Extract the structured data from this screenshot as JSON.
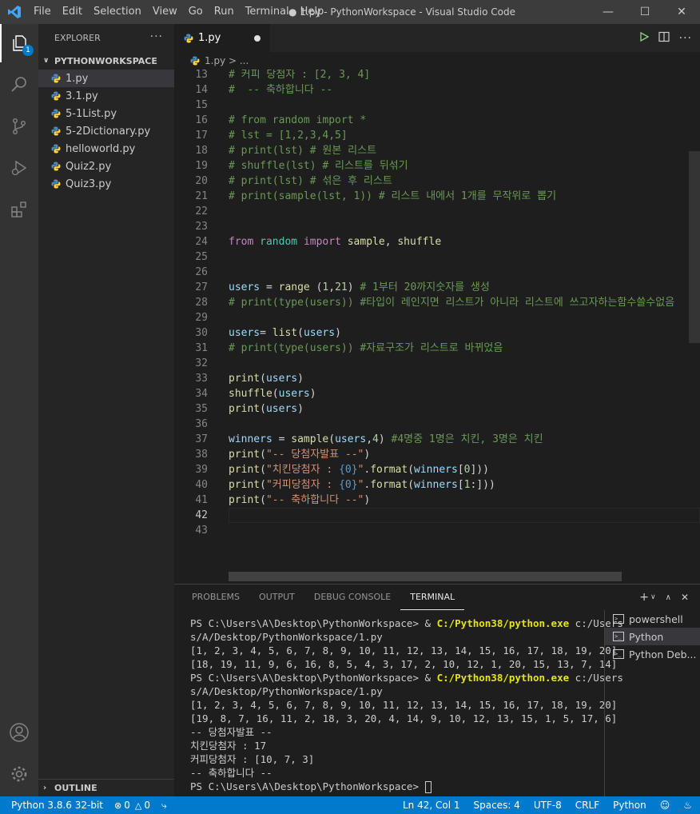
{
  "titlebar": {
    "menu": [
      "File",
      "Edit",
      "Selection",
      "View",
      "Go",
      "Run",
      "Terminal",
      "Help"
    ],
    "title": "● 1.py - PythonWorkspace - Visual Studio Code"
  },
  "activity": {
    "explorer_badge": "1"
  },
  "sidebar": {
    "header": "EXPLORER",
    "folder": "PYTHONWORKSPACE",
    "files": [
      "1.py",
      "3.1.py",
      "5-1List.py",
      "5-2Dictionary.py",
      "helloworld.py",
      "Quiz2.py",
      "Quiz3.py"
    ],
    "outline": "OUTLINE"
  },
  "editor": {
    "tab": "1.py",
    "breadcrumb": "1.py > ...",
    "lines": [
      {
        "n": "13",
        "text": "# 커피 당첨자 : [2, 3, 4]",
        "cls": "c-com"
      },
      {
        "n": "14",
        "text": "#  -- 축하합니다 --",
        "cls": "c-com"
      },
      {
        "n": "15",
        "text": ""
      },
      {
        "n": "16",
        "text": "# from random import *",
        "cls": "c-com"
      },
      {
        "n": "17",
        "text": "# lst = [1,2,3,4,5]",
        "cls": "c-com"
      },
      {
        "n": "18",
        "text": "# print(lst) # 원본 리스트",
        "cls": "c-com"
      },
      {
        "n": "19",
        "text": "# shuffle(lst) # 리스트를 뒤섞기",
        "cls": "c-com"
      },
      {
        "n": "20",
        "text": "# print(lst) # 섞은 후 리스트",
        "cls": "c-com"
      },
      {
        "n": "21",
        "text": "# print(sample(lst, 1)) # 리스트 내에서 1개를 무작위로 뽑기",
        "cls": "c-com"
      },
      {
        "n": "22",
        "text": ""
      },
      {
        "n": "23",
        "text": ""
      },
      {
        "n": "24",
        "text": "from random import sample, shuffle"
      },
      {
        "n": "25",
        "text": ""
      },
      {
        "n": "26",
        "text": ""
      },
      {
        "n": "27",
        "text": "users = range (1,21) # 1부터 20까지숫자를 생성"
      },
      {
        "n": "28",
        "text": "# print(type(users)) #타입이 레인지면 리스트가 아니라 리스트에 쓰고자하는함수쓸수없음",
        "cls": "c-com"
      },
      {
        "n": "29",
        "text": ""
      },
      {
        "n": "30",
        "text": "users= list(users)"
      },
      {
        "n": "31",
        "text": "# print(type(users)) #자료구조가 리스트로 바뀌었음",
        "cls": "c-com"
      },
      {
        "n": "32",
        "text": ""
      },
      {
        "n": "33",
        "text": "print(users)"
      },
      {
        "n": "34",
        "text": "shuffle(users)"
      },
      {
        "n": "35",
        "text": "print(users)"
      },
      {
        "n": "36",
        "text": ""
      },
      {
        "n": "37",
        "text": "winners = sample(users,4) #4명중 1명은 치킨, 3명은 치킨"
      },
      {
        "n": "38",
        "text": "print(\"-- 당첨자발표 --\")"
      },
      {
        "n": "39",
        "text": "print(\"치킨당첨자 : {0}\".format(winners[0]))"
      },
      {
        "n": "40",
        "text": "print(\"커피당첨자 : {0}\".format(winners[1:]))"
      },
      {
        "n": "41",
        "text": "print(\"-- 축하합니다 --\")"
      },
      {
        "n": "42",
        "text": ""
      },
      {
        "n": "43",
        "text": ""
      }
    ]
  },
  "panel": {
    "tabs": [
      "PROBLEMS",
      "OUTPUT",
      "DEBUG CONSOLE",
      "TERMINAL"
    ],
    "active_tab": "TERMINAL",
    "terminal_lines": [
      "PS C:\\Users\\A\\Desktop\\PythonWorkspace> & C:/Python38/python.exe c:/Users",
      "s/A/Desktop/PythonWorkspace/1.py",
      "[1, 2, 3, 4, 5, 6, 7, 8, 9, 10, 11, 12, 13, 14, 15, 16, 17, 18, 19, 20]",
      "[18, 19, 11, 9, 6, 16, 8, 5, 4, 3, 17, 2, 10, 12, 1, 20, 15, 13, 7, 14]",
      "PS C:\\Users\\A\\Desktop\\PythonWorkspace> & C:/Python38/python.exe c:/Users",
      "s/A/Desktop/PythonWorkspace/1.py",
      "[1, 2, 3, 4, 5, 6, 7, 8, 9, 10, 11, 12, 13, 14, 15, 16, 17, 18, 19, 20]",
      "[19, 8, 7, 16, 11, 2, 18, 3, 20, 4, 14, 9, 10, 12, 13, 15, 1, 5, 17, 6]",
      "-- 당첨자발표 --",
      "치킨당첨자 : 17",
      "커피당첨자 : [10, 7, 3]",
      "-- 축하합니다 --",
      "PS C:\\Users\\A\\Desktop\\PythonWorkspace> "
    ],
    "terminals": [
      "powershell",
      "Python",
      "Python Deb..."
    ]
  },
  "statusbar": {
    "interpreter": "Python 3.8.6 32-bit",
    "errors": "0",
    "warnings": "0",
    "position": "Ln 42, Col 1",
    "spaces": "Spaces: 4",
    "encoding": "UTF-8",
    "eol": "CRLF",
    "language": "Python"
  }
}
